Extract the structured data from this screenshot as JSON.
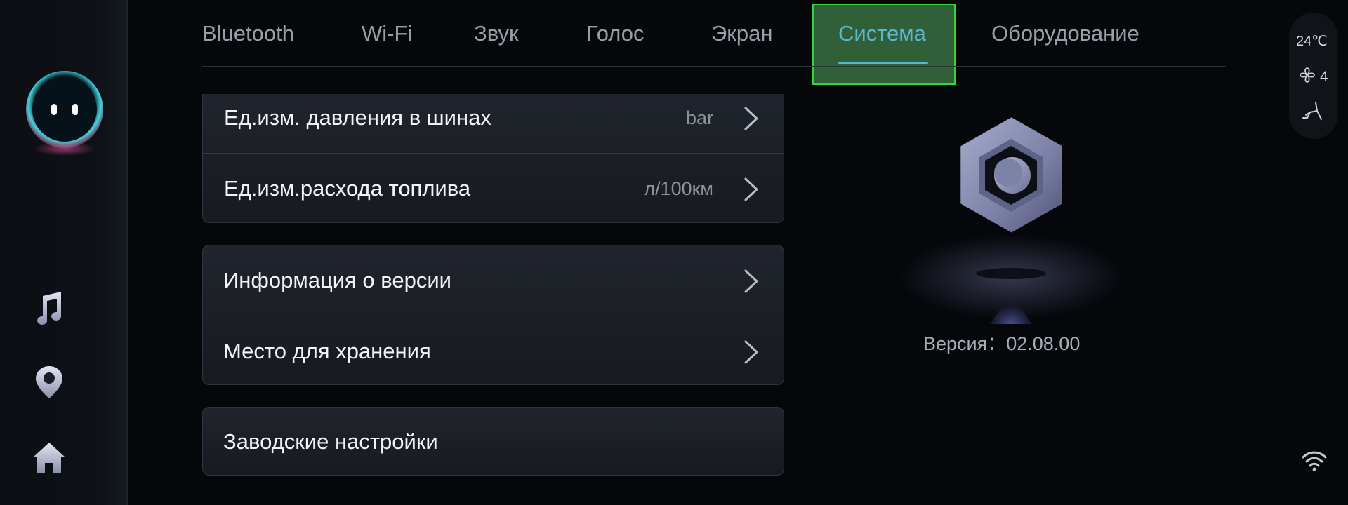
{
  "tabs": [
    {
      "label": "Bluetooth",
      "active": false
    },
    {
      "label": "Wi-Fi",
      "active": false
    },
    {
      "label": "Звук",
      "active": false
    },
    {
      "label": "Голос",
      "active": false
    },
    {
      "label": "Экран",
      "active": false
    },
    {
      "label": "Система",
      "active": true
    },
    {
      "label": "Оборудование",
      "active": false
    }
  ],
  "units_card": {
    "rows": [
      {
        "label": "Ед.изм. давления в шинах",
        "value": "bar"
      },
      {
        "label": "Ед.изм.расхода топлива",
        "value": "л/100км"
      }
    ]
  },
  "info_card": {
    "rows": [
      {
        "label": "Информация о версии"
      },
      {
        "label": "Место для хранения"
      }
    ]
  },
  "reset_card": {
    "label": "Заводские настройки"
  },
  "version_text": "Версия：02.08.00",
  "status_bar": {
    "temperature": "24℃",
    "fan_level": "4"
  },
  "rail": {
    "icons": [
      "music-icon",
      "location-pin-icon",
      "home-icon"
    ]
  },
  "colors": {
    "accent": "#58b8d4",
    "highlight_border": "#34d43a",
    "background": "#05070b"
  }
}
